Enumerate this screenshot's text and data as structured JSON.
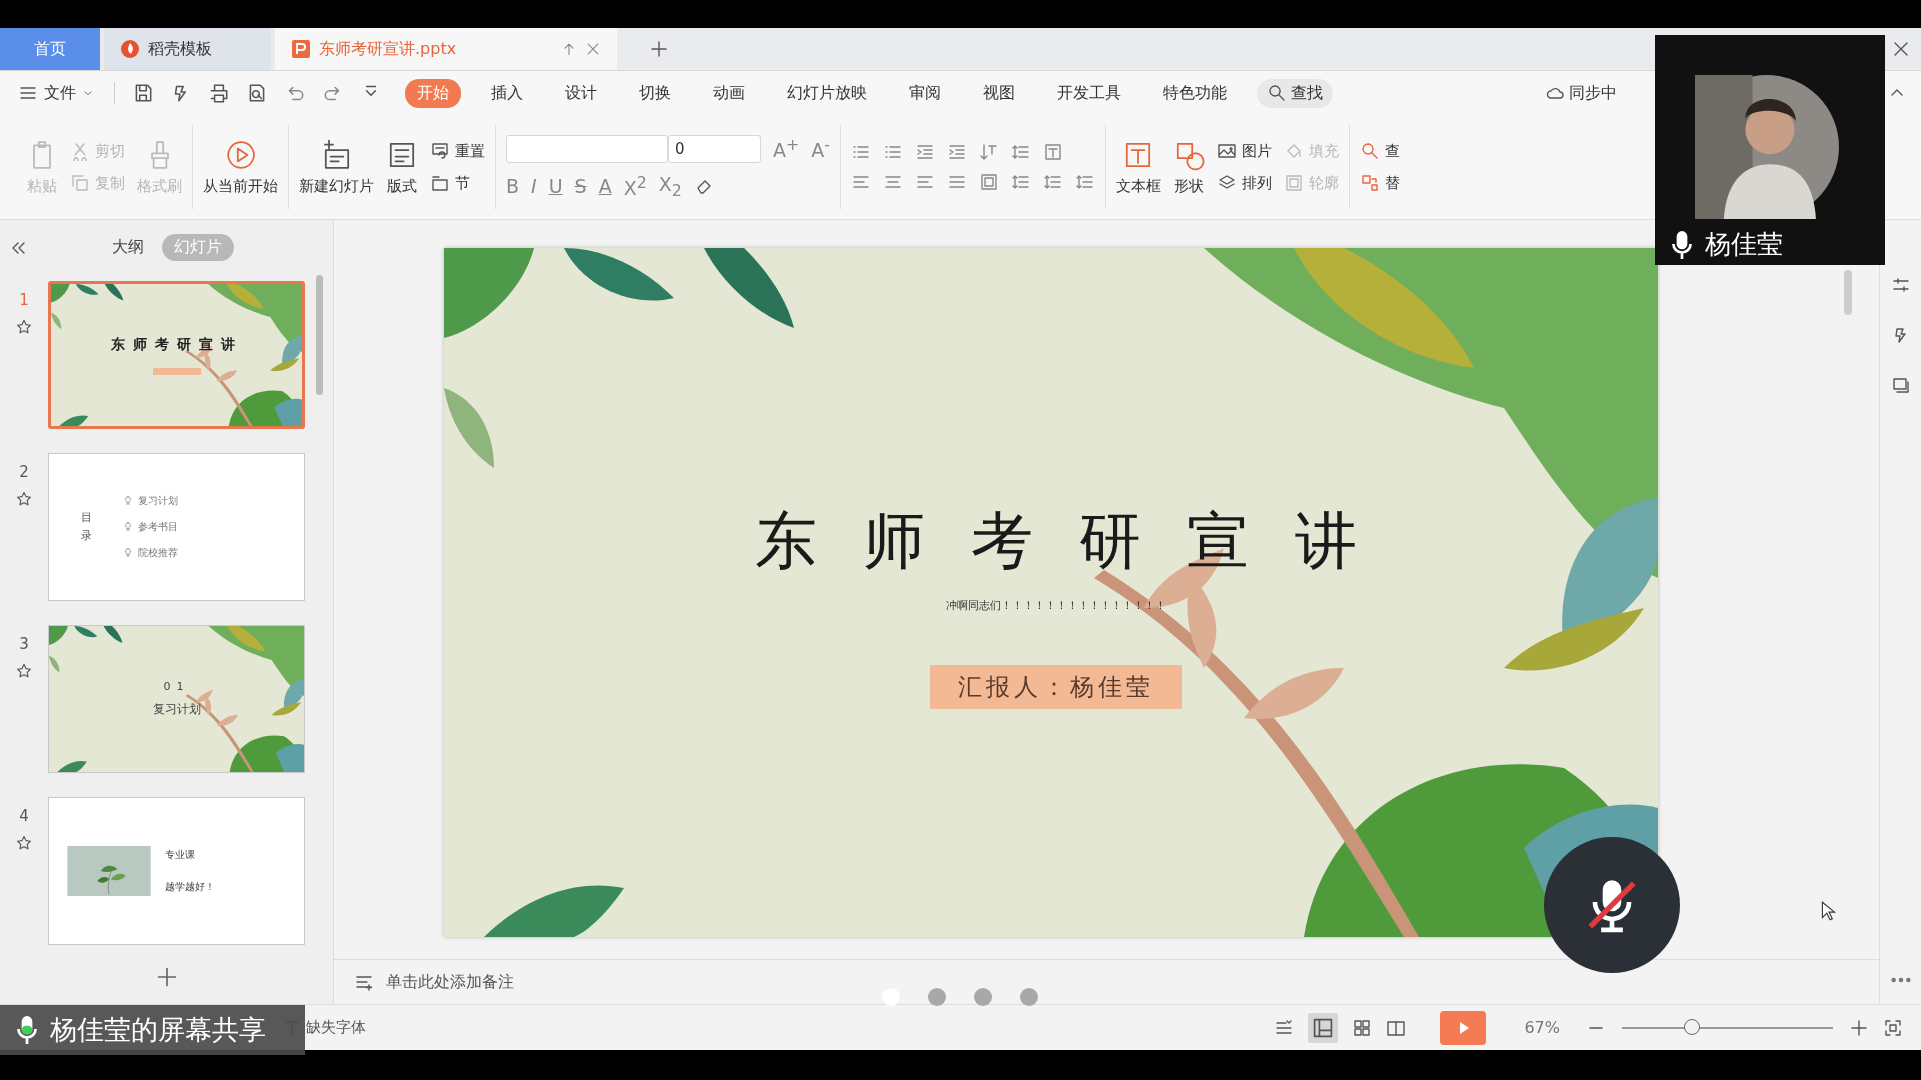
{
  "tabs": [
    {
      "label": "首页",
      "kind": "home",
      "selected": false
    },
    {
      "label": "稻壳模板",
      "kind": "template",
      "selected": false
    },
    {
      "label": "东师考研宣讲.pptx",
      "kind": "document",
      "selected": true
    }
  ],
  "menu": {
    "file": "文件",
    "ribbon_tabs": [
      {
        "label": "开始",
        "selected": true
      },
      {
        "label": "插入",
        "selected": false
      },
      {
        "label": "设计",
        "selected": false
      },
      {
        "label": "切换",
        "selected": false
      },
      {
        "label": "动画",
        "selected": false
      },
      {
        "label": "幻灯片放映",
        "selected": false
      },
      {
        "label": "审阅",
        "selected": false
      },
      {
        "label": "视图",
        "selected": false
      },
      {
        "label": "开发工具",
        "selected": false
      },
      {
        "label": "特色功能",
        "selected": false
      }
    ],
    "search": "查找",
    "sync": "同步中"
  },
  "toolbar": {
    "clipboard": [
      {
        "label": "粘贴",
        "disabled": true
      },
      {
        "label": "剪切",
        "disabled": true
      },
      {
        "label": "复制",
        "disabled": true
      },
      {
        "label": "格式刷",
        "disabled": true
      }
    ],
    "start_from_current": "从当前开始",
    "slides_group": {
      "new_slide": "新建幻灯片",
      "layout": "版式",
      "reset": "重置",
      "section": "节"
    },
    "font": {
      "size": "0",
      "grow": "A$^{+}$",
      "shrink": "A$^{-}$",
      "formats": [
        "B",
        "I",
        "U",
        "S",
        "A",
        "X$^{2}$",
        "X$_{2}$"
      ]
    },
    "insert_group": [
      {
        "label": "文本框",
        "disabled": false
      },
      {
        "label": "形状",
        "disabled": false
      },
      {
        "label": "图片",
        "disabled": false
      },
      {
        "label": "排列",
        "disabled": false
      },
      {
        "label": "填充",
        "disabled": true
      },
      {
        "label": "轮廓",
        "disabled": true
      }
    ],
    "find_group": [
      "查",
      "替"
    ]
  },
  "panel": {
    "views": [
      {
        "label": "大纲",
        "selected": false
      },
      {
        "label": "幻灯片",
        "selected": true
      }
    ],
    "slides": [
      {
        "number": "1",
        "kind": "cover",
        "selected": true,
        "title": "东师考研宣讲"
      },
      {
        "number": "2",
        "kind": "contents",
        "selected": false,
        "heading": "目录",
        "items": [
          "复习计划",
          "参考书目",
          "院校推荐"
        ]
      },
      {
        "number": "3",
        "kind": "section",
        "selected": false,
        "index": "01",
        "title": "复习计划"
      },
      {
        "number": "4",
        "selected": false,
        "caption": "专业课",
        "title": "越学越好！"
      }
    ]
  },
  "slide": {
    "kind": "picture",
    "title": "东师考研宣讲",
    "subtitle": "冲啊同志们！！！！！！！！！！！！！！！",
    "presenter": "汇报人：杨佳莹"
  },
  "notes": {
    "placeholder": "单击此处添加备注"
  },
  "status_bar": {
    "missing_fonts": "缺失字体",
    "zoom": "67%",
    "zoom_slider": {
      "level": 0.32
    }
  },
  "meeting": {
    "speaker": "杨佳莹",
    "share_label": "杨佳莹的屏幕共享",
    "muted": true,
    "pages": [
      {
        "selected": true
      },
      {
        "selected": false
      },
      {
        "selected": false
      },
      {
        "selected": false
      }
    ]
  }
}
